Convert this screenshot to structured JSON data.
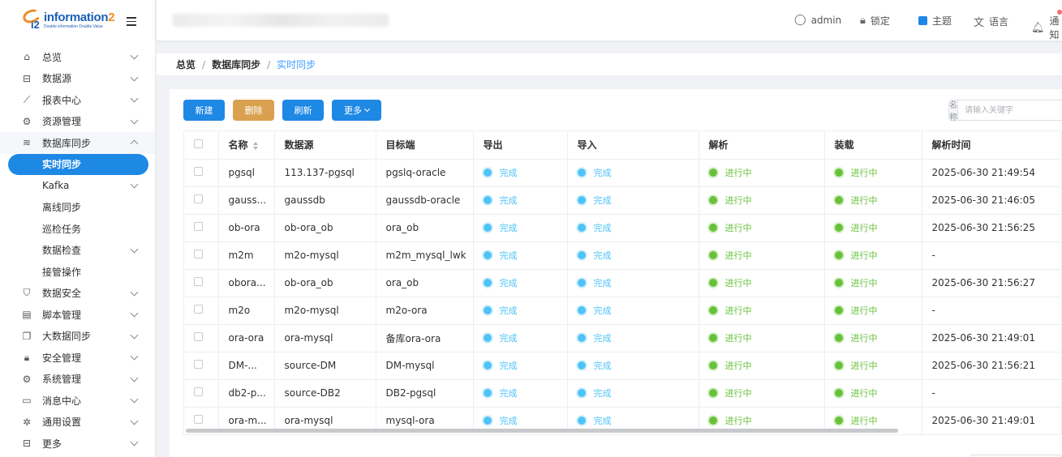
{
  "logo": {
    "brand_prefix": "information",
    "brand_suffix": "2",
    "mark": "i2",
    "tagline": "Double information Double Value"
  },
  "sidebar": {
    "items": [
      {
        "label": "总览",
        "icon": "home-icon",
        "expanded": false
      },
      {
        "label": "数据源",
        "icon": "database-icon",
        "expanded": false
      },
      {
        "label": "报表中心",
        "icon": "chart-icon",
        "expanded": false
      },
      {
        "label": "资源管理",
        "icon": "gears-icon",
        "expanded": false
      },
      {
        "label": "数据库同步",
        "icon": "db-stack-icon",
        "expanded": true
      }
    ],
    "sub_items": [
      {
        "label": "实时同步",
        "active": true,
        "has_children": false
      },
      {
        "label": "Kafka",
        "active": false,
        "has_children": true
      },
      {
        "label": "离线同步",
        "active": false,
        "has_children": false
      },
      {
        "label": "巡检任务",
        "active": false,
        "has_children": false
      },
      {
        "label": "数据检查",
        "active": false,
        "has_children": true
      },
      {
        "label": "接管操作",
        "active": false,
        "has_children": false
      }
    ],
    "items_after": [
      {
        "label": "数据安全",
        "icon": "shield-icon"
      },
      {
        "label": "脚本管理",
        "icon": "script-icon"
      },
      {
        "label": "大数据同步",
        "icon": "copy-icon"
      },
      {
        "label": "安全管理",
        "icon": "lock-icon"
      },
      {
        "label": "系统管理",
        "icon": "gear-icon"
      },
      {
        "label": "消息中心",
        "icon": "monitor-icon"
      },
      {
        "label": "通用设置",
        "icon": "settings-icon"
      },
      {
        "label": "更多",
        "icon": "more-icon"
      }
    ]
  },
  "header": {
    "user": "admin",
    "lock": "锁定",
    "theme": "主题",
    "language": "语言",
    "notify": "通知"
  },
  "breadcrumb": [
    "总览",
    "数据库同步",
    "实时同步"
  ],
  "toolbar": {
    "new": "新建",
    "delete": "删除",
    "refresh": "刷新",
    "more": "更多"
  },
  "search": {
    "label": "名称",
    "placeholder": "请输入关键字"
  },
  "table": {
    "columns": [
      "名称",
      "数据源",
      "目标端",
      "导出",
      "导入",
      "解析",
      "装载",
      "解析时间"
    ],
    "status_done": "完成",
    "status_running": "进行中",
    "rows": [
      {
        "name": "pgsql",
        "source": "113.137-pgsql",
        "target": "pgslq-oracle",
        "export": "完成",
        "import": "完成",
        "parse": "进行中",
        "load": "进行中",
        "time": "2025-06-30 21:49:54"
      },
      {
        "name": "gauss...",
        "source": "gaussdb",
        "target": "gaussdb-oracle",
        "export": "完成",
        "import": "完成",
        "parse": "进行中",
        "load": "进行中",
        "time": "2025-06-30 21:46:05"
      },
      {
        "name": "ob-ora",
        "source": "ob-ora_ob",
        "target": "ora_ob",
        "export": "完成",
        "import": "完成",
        "parse": "进行中",
        "load": "进行中",
        "time": "2025-06-30 21:56:25"
      },
      {
        "name": "m2m",
        "source": "m2o-mysql",
        "target": "m2m_mysql_lwk",
        "export": "完成",
        "import": "完成",
        "parse": "进行中",
        "load": "进行中",
        "time": "-"
      },
      {
        "name": "obora...",
        "source": "ob-ora_ob",
        "target": "ora_ob",
        "export": "完成",
        "import": "完成",
        "parse": "进行中",
        "load": "进行中",
        "time": "2025-06-30 21:56:27"
      },
      {
        "name": "m2o",
        "source": "m2o-mysql",
        "target": "m2o-ora",
        "export": "完成",
        "import": "完成",
        "parse": "进行中",
        "load": "进行中",
        "time": "-"
      },
      {
        "name": "ora-ora",
        "source": "ora-mysql",
        "target": "备库ora-ora",
        "export": "完成",
        "import": "完成",
        "parse": "进行中",
        "load": "进行中",
        "time": "2025-06-30 21:49:01"
      },
      {
        "name": "DM-...",
        "source": "source-DM",
        "target": "DM-mysql",
        "export": "完成",
        "import": "完成",
        "parse": "进行中",
        "load": "进行中",
        "time": "2025-06-30 21:56:21"
      },
      {
        "name": "db2-p...",
        "source": "source-DB2",
        "target": "DB2-pgsql",
        "export": "完成",
        "import": "完成",
        "parse": "进行中",
        "load": "进行中",
        "time": "-"
      },
      {
        "name": "ora-m...",
        "source": "ora-mysql",
        "target": "mysql-ora",
        "export": "完成",
        "import": "完成",
        "parse": "进行中",
        "load": "进行中",
        "time": "2025-06-30 21:49:01"
      }
    ]
  },
  "colors": {
    "primary": "#1e88e5",
    "delete": "#d9a14f",
    "done": "#4fc3f7",
    "running": "#67c23a"
  }
}
